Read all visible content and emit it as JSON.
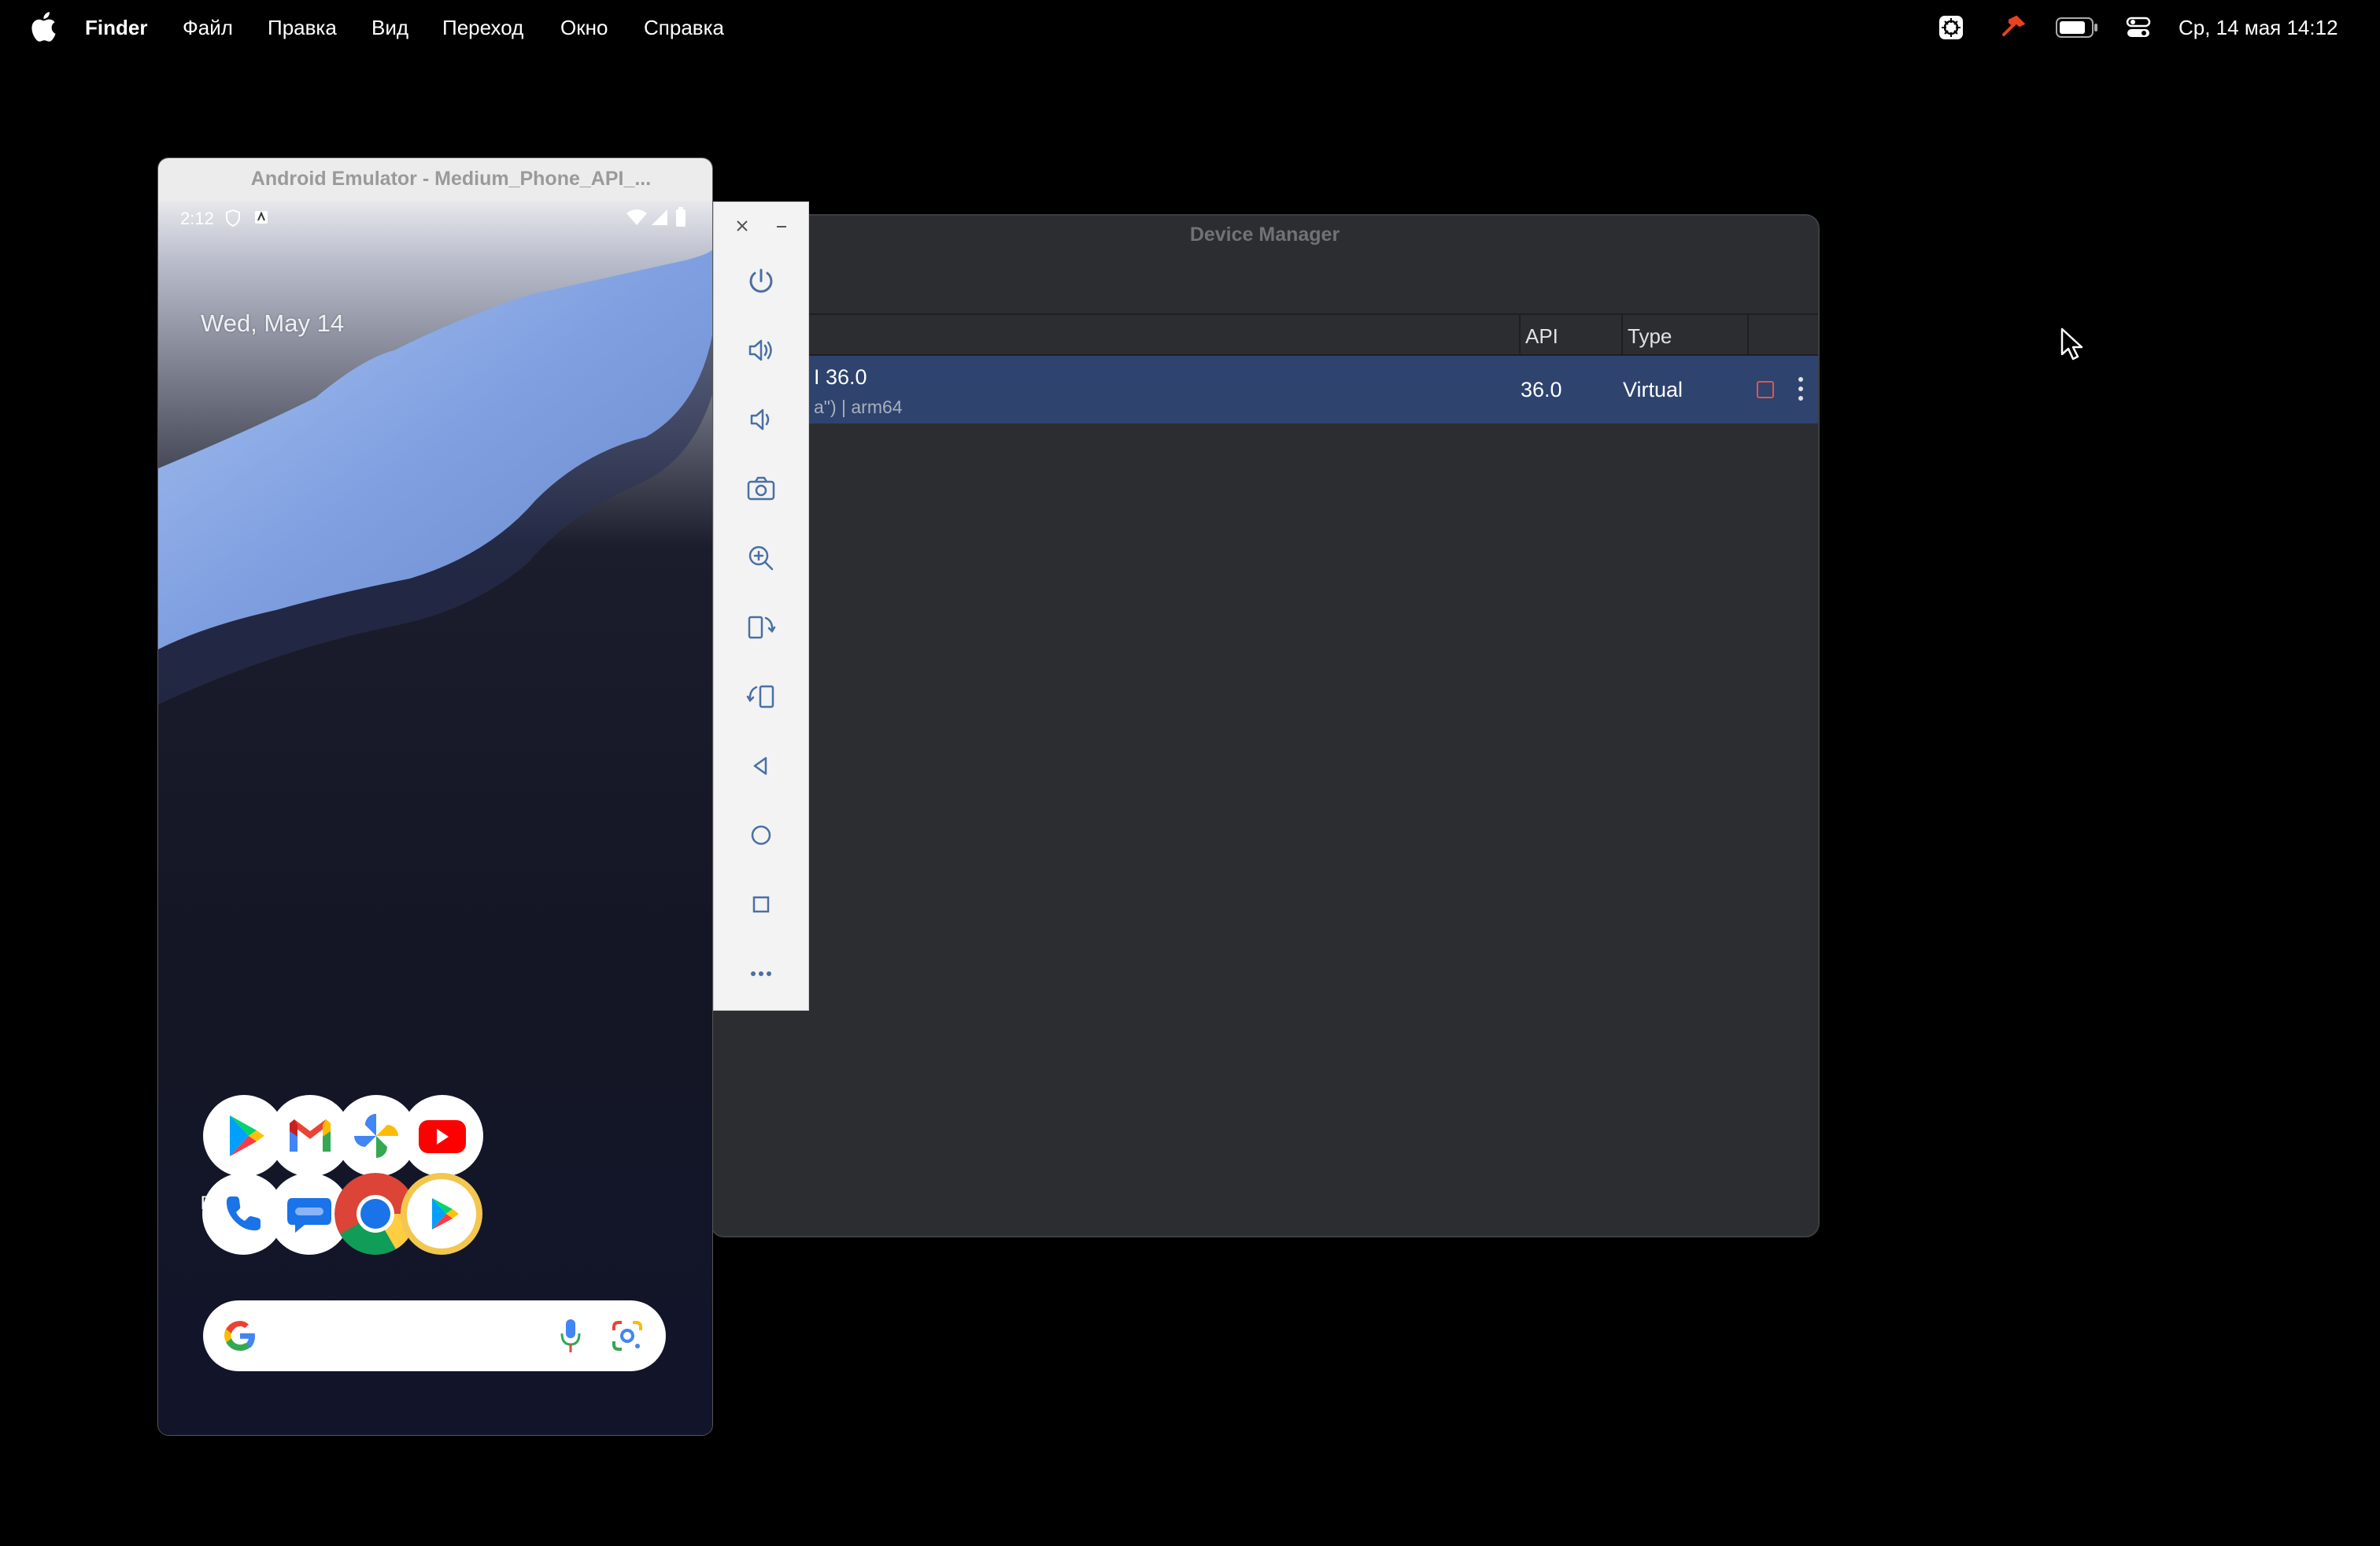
{
  "menubar": {
    "apple_icon": "apple-logo-icon",
    "app_name": "Finder",
    "items": [
      "Файл",
      "Правка",
      "Вид",
      "Переход",
      "Окно",
      "Справка"
    ],
    "status_icons": [
      "screen-share-icon",
      "hammer-icon",
      "battery-icon",
      "control-center-icon"
    ],
    "clock": "Ср, 14 мая  14:12",
    "hammer_color": "#e8421e"
  },
  "device_manager": {
    "title": "Device Manager",
    "columns": {
      "api": "API",
      "type": "Type"
    },
    "device": {
      "name": "I 36.0",
      "subtitle": "a\") | arm64",
      "api": "36.0",
      "type": "Virtual"
    },
    "row_color": "#2e436e"
  },
  "emulator_toolbar": {
    "buttons": [
      "power-icon",
      "volume-up-icon",
      "volume-down-icon",
      "camera-icon",
      "zoom-icon",
      "rotate-left-icon",
      "rotate-right-icon",
      "back-icon",
      "home-icon",
      "overview-icon",
      "more-icon"
    ]
  },
  "emulator": {
    "title": "Android Emulator - Medium_Phone_API_...",
    "status_time": "2:12",
    "date": "Wed, May 14",
    "apps_row1": [
      {
        "label": "Play Store",
        "icon": "play-store-icon"
      },
      {
        "label": "Gmail",
        "icon": "gmail-icon"
      },
      {
        "label": "Photos",
        "icon": "photos-icon"
      },
      {
        "label": "YouTube",
        "icon": "youtube-icon"
      }
    ],
    "apps_row2": [
      {
        "icon": "phone-icon"
      },
      {
        "icon": "messages-icon"
      },
      {
        "icon": "chrome-icon"
      },
      {
        "icon": "play-games-icon"
      }
    ]
  }
}
